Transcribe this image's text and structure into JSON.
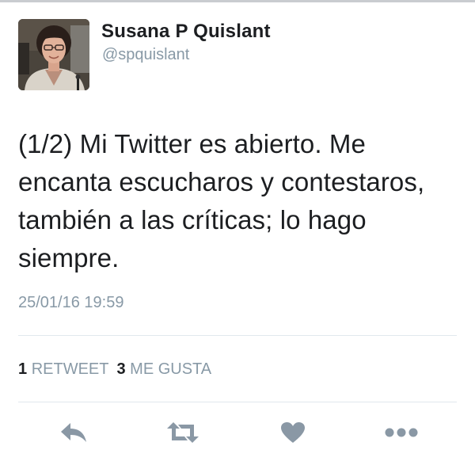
{
  "user": {
    "display_name": "Susana P Quislant",
    "handle": "@spquislant",
    "avatar_icon": "profile-photo"
  },
  "tweet": {
    "text": "(1/2) Mi Twitter es abierto. Me encanta escucharos y contestaros, también a las críticas; lo hago siempre.",
    "timestamp": "25/01/16 19:59"
  },
  "stats": {
    "retweets_count": "1",
    "retweets_label": "RETWEET",
    "likes_count": "3",
    "likes_label": "ME GUSTA"
  },
  "actions": [
    {
      "name": "reply",
      "icon": "reply-icon"
    },
    {
      "name": "retweet",
      "icon": "retweet-icon"
    },
    {
      "name": "like",
      "icon": "heart-icon"
    },
    {
      "name": "more",
      "icon": "more-dots-icon"
    }
  ],
  "colors": {
    "text_primary": "#1c1e21",
    "text_secondary": "#8899a6",
    "icon_gray": "#8a98a5",
    "divider": "#e1e8ed"
  }
}
